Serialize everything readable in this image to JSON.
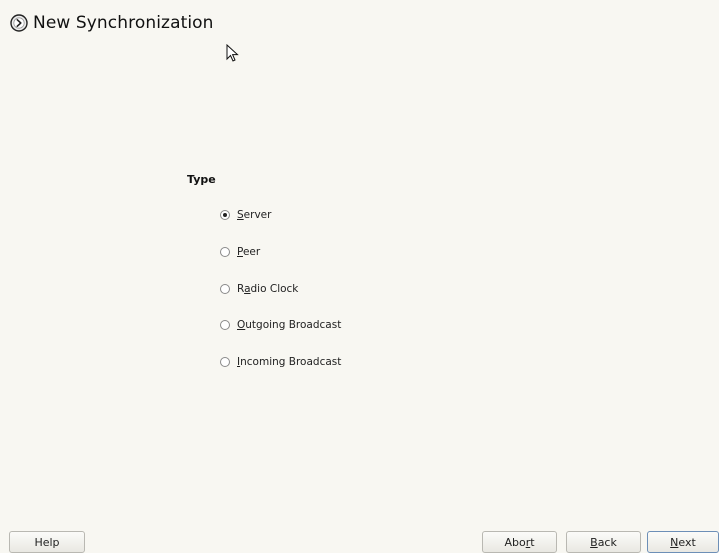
{
  "header": {
    "title": "New Synchronization",
    "icon": "circle-arrow-icon"
  },
  "type_group": {
    "label": "Type",
    "selected": "server",
    "options": [
      {
        "id": "server",
        "pre": "",
        "key": "S",
        "post": "erver",
        "checked": true
      },
      {
        "id": "peer",
        "pre": "",
        "key": "P",
        "post": "eer",
        "checked": false
      },
      {
        "id": "radio-clock",
        "pre": "R",
        "key": "a",
        "post": "dio Clock",
        "checked": false
      },
      {
        "id": "outgoing-broadcast",
        "pre": "",
        "key": "O",
        "post": "utgoing Broadcast",
        "checked": false
      },
      {
        "id": "incoming-broadcast",
        "pre": "",
        "key": "I",
        "post": "ncoming Broadcast",
        "checked": false
      }
    ]
  },
  "buttons": {
    "help": {
      "pre": "Help",
      "key": "",
      "post": ""
    },
    "abort": {
      "pre": "Abo",
      "key": "r",
      "post": "t"
    },
    "back": {
      "pre": "",
      "key": "B",
      "post": "ack"
    },
    "next": {
      "pre": "",
      "key": "N",
      "post": "ext"
    }
  }
}
